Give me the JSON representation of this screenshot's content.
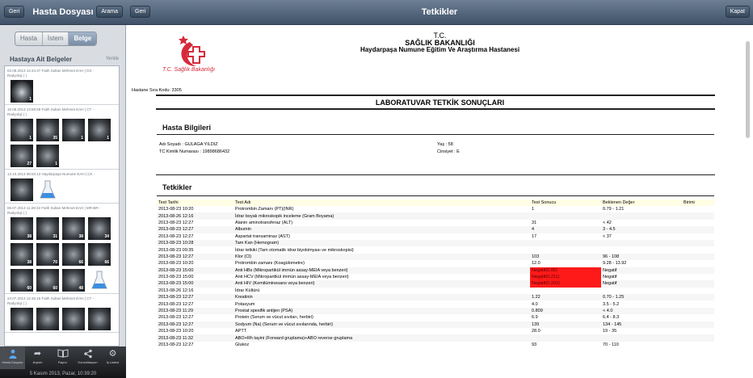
{
  "left_nav": {
    "back": "Geri",
    "title": "Hasta Dosyası",
    "search": "Arama"
  },
  "right_nav": {
    "back": "Geri",
    "title": "Tetkikler",
    "close": "Kapat"
  },
  "segments": [
    "Hasta",
    "İstem",
    "Belge"
  ],
  "sidebar": {
    "title": "Hastaya Ait Belgeler",
    "refresh": "Yenile",
    "docs": [
      {
        "head": "02.08.2013 14:44:47 Fatih Sultan Mehmet EAH | DX -",
        "head2": "Radyoloji ( )",
        "thumbs": [
          {
            "type": "chest",
            "num": "1"
          }
        ]
      },
      {
        "head": "10.08.2013 13:59:58 Fatih Sultan Mehmet EAH | CT -",
        "head2": "Radyoloji ( )",
        "thumbs": [
          {
            "type": "ct",
            "num": "1"
          },
          {
            "type": "ct",
            "num": "35"
          },
          {
            "type": "ct",
            "num": "1"
          },
          {
            "type": "ct",
            "num": "1"
          },
          {
            "type": "ct",
            "num": "27"
          },
          {
            "type": "ct",
            "num": "1"
          }
        ]
      },
      {
        "head": "13.10.2013 08:53:12 Haydarpaşa Numune EAH | CK -",
        "head2": "",
        "thumbs": [
          {
            "type": "ct",
            "num": ""
          },
          {
            "type": "flask",
            "num": ""
          }
        ]
      },
      {
        "head": "06.07.2013 11:28:22 Fatih Sultan Mehmet EAH | MR-BR -",
        "head2": "Radyoloji ( )",
        "thumbs": [
          {
            "type": "ct",
            "num": "38"
          },
          {
            "type": "ct",
            "num": "31"
          },
          {
            "type": "ct",
            "num": "38"
          },
          {
            "type": "ct",
            "num": "34"
          },
          {
            "type": "ct",
            "num": "38"
          },
          {
            "type": "ct",
            "num": "70"
          },
          {
            "type": "ct",
            "num": "66"
          },
          {
            "type": "ct",
            "num": "66"
          },
          {
            "type": "ct",
            "num": "60"
          },
          {
            "type": "ct",
            "num": "60"
          },
          {
            "type": "ct",
            "num": "48"
          },
          {
            "type": "flask",
            "num": ""
          }
        ]
      },
      {
        "head": "24.07.2013 12:45:16 Fatih Sultan Mehmet EAH | CT -",
        "head2": "Radyoloji ( )",
        "thumbs": [
          {
            "type": "ct",
            "num": ""
          },
          {
            "type": "ct",
            "num": ""
          },
          {
            "type": "ct",
            "num": ""
          },
          {
            "type": "ct",
            "num": ""
          }
        ]
      }
    ]
  },
  "tabbar": {
    "tabs": [
      {
        "label": "Hasta Dosyası",
        "icon": "person-icon"
      },
      {
        "label": "Arşivle",
        "icon": "share-arrow-icon"
      },
      {
        "label": "Rapor",
        "icon": "book-icon"
      },
      {
        "label": "Konsültasyon",
        "icon": "share-icon"
      },
      {
        "label": "İş Listesi",
        "icon": "gear-icon"
      }
    ],
    "date": "5 Kasım 2013, Pazar, 10:39:20"
  },
  "document": {
    "header": [
      "T.C.",
      "SAĞLIK BAKANLIĞI",
      "Haydarpaşa Numune Eğitim Ve Araştırma Hastanesi"
    ],
    "logo_text": "T.C. Sağlık Bakanlığı",
    "protocol": "Hastane Sıra Kodu: 3305",
    "report_title": "LABORATUVAR TETKİK SONUÇLARI",
    "patient_title": "Hasta Bilgileri",
    "patient": {
      "name": "Adı Soyadı : GULAGA YILDIZ",
      "tc": "TC Kimlik Numarası : 19898686432",
      "age": "Yaş : 58",
      "gender": "Cinsiyet : E"
    },
    "tests_title": "Tetkikler",
    "columns": [
      "Test Tarihi",
      "Test Adı",
      "Test Sonucu",
      "Beklenen Değer",
      "Birimi"
    ],
    "rows": [
      [
        "2013-08-23 10:20",
        "Protrombin Zamanı (PT)(INR)",
        "1",
        "0.79 - 1.21",
        "",
        false
      ],
      [
        "2013-08-26 12:16",
        "İdrar boyalı mikroskopik inceleme (Gram Boyama)",
        "",
        "",
        "",
        false
      ],
      [
        "2013-08-23 12:27",
        "Alanin aminotransferaz (ALT)",
        "31",
        "< 42",
        "",
        false
      ],
      [
        "2013-08-23 12:27",
        "Albumin",
        "4",
        "3 - 4.5",
        "",
        false
      ],
      [
        "2013-08-23 12:27",
        "Aspartat transaminaz (AST)",
        "17",
        "< 37",
        "",
        false
      ],
      [
        "2013-08-23 10:28",
        "Tam Kan (Hemogram)",
        "",
        "",
        "",
        false
      ],
      [
        "2013-08-23 09:35",
        "İdrar tetkiki (Tam otomatik idrar biyokimyası ve mikroskopisi)",
        "",
        "",
        "",
        false
      ],
      [
        "2013-08-23 12:27",
        "Klor (Cl)",
        "103",
        "96 - 108",
        "",
        false
      ],
      [
        "2013-08-23 10:20",
        "Protrombin zamanı (Koagülometre)",
        "12.0",
        "9.28 - 13.92",
        "",
        false
      ],
      [
        "2013-08-23 15:00",
        "Anti HBs (Mikropartikül immün assay-MEIA veya benzeri)",
        "Negatif(0.00)",
        "Negatif",
        "",
        true
      ],
      [
        "2013-08-23 15:00",
        "Anti HCV (Mikropartikül immün assay-MEIA veya benzeri)",
        "Negatif(0.211)",
        "Negatif",
        "",
        true
      ],
      [
        "2013-08-23 15:00",
        "Anti HIV (Kemilüminesans veya benzeri)",
        "Negatif(0.202)",
        "Negatif",
        "",
        true
      ],
      [
        "2013-08-26 12:16",
        "İdrar Kültürü",
        "",
        "",
        "",
        false
      ],
      [
        "2013-08-23 12:27",
        "Kreatinin",
        "1.22",
        "0.70 - 1.25",
        "",
        false
      ],
      [
        "2013-08-23 12:27",
        "Potasyum",
        "4.0",
        "3.5 - 5.2",
        "",
        false
      ],
      [
        "2013-08-23 11:29",
        "Prostat spesifik antijen (PSA)",
        "0.809",
        "< 4.0",
        "",
        false
      ],
      [
        "2013-08-23 12:27",
        "Protein (Serum ve vücut sıvıları, herbiri)",
        "6.9",
        "6.4 - 8.3",
        "",
        false
      ],
      [
        "2013-08-23 12:27",
        "Sodyum (Na) (Serum ve vücut sıvılarında, herbiri)",
        "139",
        "134 - 145",
        "",
        false
      ],
      [
        "2013-08-23 10:20",
        "APTT",
        "28.0",
        "19 - 35",
        "",
        false
      ],
      [
        "2013-08-23 11:32",
        "ABO+Rh tayini (Forward gruplama)+ABO reverse gruplama",
        "",
        "",
        "",
        false
      ],
      [
        "2013-08-23 12:27",
        "Glukoz",
        "93",
        "70 - 110",
        "",
        false
      ]
    ]
  },
  "colors": {
    "navbar": "#4f6178",
    "flag": "#ff1a1a",
    "table_header": "#fffde3",
    "tab_active": "#5aa9ee"
  }
}
